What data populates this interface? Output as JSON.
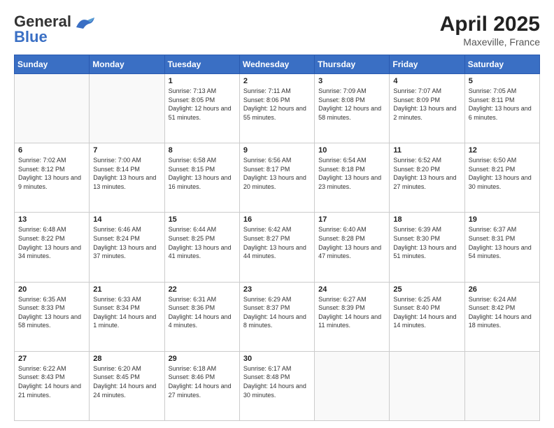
{
  "header": {
    "logo_line1": "General",
    "logo_line2": "Blue",
    "month_year": "April 2025",
    "location": "Maxeville, France"
  },
  "days_of_week": [
    "Sunday",
    "Monday",
    "Tuesday",
    "Wednesday",
    "Thursday",
    "Friday",
    "Saturday"
  ],
  "weeks": [
    [
      {
        "num": "",
        "info": ""
      },
      {
        "num": "",
        "info": ""
      },
      {
        "num": "1",
        "info": "Sunrise: 7:13 AM\nSunset: 8:05 PM\nDaylight: 12 hours and 51 minutes."
      },
      {
        "num": "2",
        "info": "Sunrise: 7:11 AM\nSunset: 8:06 PM\nDaylight: 12 hours and 55 minutes."
      },
      {
        "num": "3",
        "info": "Sunrise: 7:09 AM\nSunset: 8:08 PM\nDaylight: 12 hours and 58 minutes."
      },
      {
        "num": "4",
        "info": "Sunrise: 7:07 AM\nSunset: 8:09 PM\nDaylight: 13 hours and 2 minutes."
      },
      {
        "num": "5",
        "info": "Sunrise: 7:05 AM\nSunset: 8:11 PM\nDaylight: 13 hours and 6 minutes."
      }
    ],
    [
      {
        "num": "6",
        "info": "Sunrise: 7:02 AM\nSunset: 8:12 PM\nDaylight: 13 hours and 9 minutes."
      },
      {
        "num": "7",
        "info": "Sunrise: 7:00 AM\nSunset: 8:14 PM\nDaylight: 13 hours and 13 minutes."
      },
      {
        "num": "8",
        "info": "Sunrise: 6:58 AM\nSunset: 8:15 PM\nDaylight: 13 hours and 16 minutes."
      },
      {
        "num": "9",
        "info": "Sunrise: 6:56 AM\nSunset: 8:17 PM\nDaylight: 13 hours and 20 minutes."
      },
      {
        "num": "10",
        "info": "Sunrise: 6:54 AM\nSunset: 8:18 PM\nDaylight: 13 hours and 23 minutes."
      },
      {
        "num": "11",
        "info": "Sunrise: 6:52 AM\nSunset: 8:20 PM\nDaylight: 13 hours and 27 minutes."
      },
      {
        "num": "12",
        "info": "Sunrise: 6:50 AM\nSunset: 8:21 PM\nDaylight: 13 hours and 30 minutes."
      }
    ],
    [
      {
        "num": "13",
        "info": "Sunrise: 6:48 AM\nSunset: 8:22 PM\nDaylight: 13 hours and 34 minutes."
      },
      {
        "num": "14",
        "info": "Sunrise: 6:46 AM\nSunset: 8:24 PM\nDaylight: 13 hours and 37 minutes."
      },
      {
        "num": "15",
        "info": "Sunrise: 6:44 AM\nSunset: 8:25 PM\nDaylight: 13 hours and 41 minutes."
      },
      {
        "num": "16",
        "info": "Sunrise: 6:42 AM\nSunset: 8:27 PM\nDaylight: 13 hours and 44 minutes."
      },
      {
        "num": "17",
        "info": "Sunrise: 6:40 AM\nSunset: 8:28 PM\nDaylight: 13 hours and 47 minutes."
      },
      {
        "num": "18",
        "info": "Sunrise: 6:39 AM\nSunset: 8:30 PM\nDaylight: 13 hours and 51 minutes."
      },
      {
        "num": "19",
        "info": "Sunrise: 6:37 AM\nSunset: 8:31 PM\nDaylight: 13 hours and 54 minutes."
      }
    ],
    [
      {
        "num": "20",
        "info": "Sunrise: 6:35 AM\nSunset: 8:33 PM\nDaylight: 13 hours and 58 minutes."
      },
      {
        "num": "21",
        "info": "Sunrise: 6:33 AM\nSunset: 8:34 PM\nDaylight: 14 hours and 1 minute."
      },
      {
        "num": "22",
        "info": "Sunrise: 6:31 AM\nSunset: 8:36 PM\nDaylight: 14 hours and 4 minutes."
      },
      {
        "num": "23",
        "info": "Sunrise: 6:29 AM\nSunset: 8:37 PM\nDaylight: 14 hours and 8 minutes."
      },
      {
        "num": "24",
        "info": "Sunrise: 6:27 AM\nSunset: 8:39 PM\nDaylight: 14 hours and 11 minutes."
      },
      {
        "num": "25",
        "info": "Sunrise: 6:25 AM\nSunset: 8:40 PM\nDaylight: 14 hours and 14 minutes."
      },
      {
        "num": "26",
        "info": "Sunrise: 6:24 AM\nSunset: 8:42 PM\nDaylight: 14 hours and 18 minutes."
      }
    ],
    [
      {
        "num": "27",
        "info": "Sunrise: 6:22 AM\nSunset: 8:43 PM\nDaylight: 14 hours and 21 minutes."
      },
      {
        "num": "28",
        "info": "Sunrise: 6:20 AM\nSunset: 8:45 PM\nDaylight: 14 hours and 24 minutes."
      },
      {
        "num": "29",
        "info": "Sunrise: 6:18 AM\nSunset: 8:46 PM\nDaylight: 14 hours and 27 minutes."
      },
      {
        "num": "30",
        "info": "Sunrise: 6:17 AM\nSunset: 8:48 PM\nDaylight: 14 hours and 30 minutes."
      },
      {
        "num": "",
        "info": ""
      },
      {
        "num": "",
        "info": ""
      },
      {
        "num": "",
        "info": ""
      }
    ]
  ]
}
